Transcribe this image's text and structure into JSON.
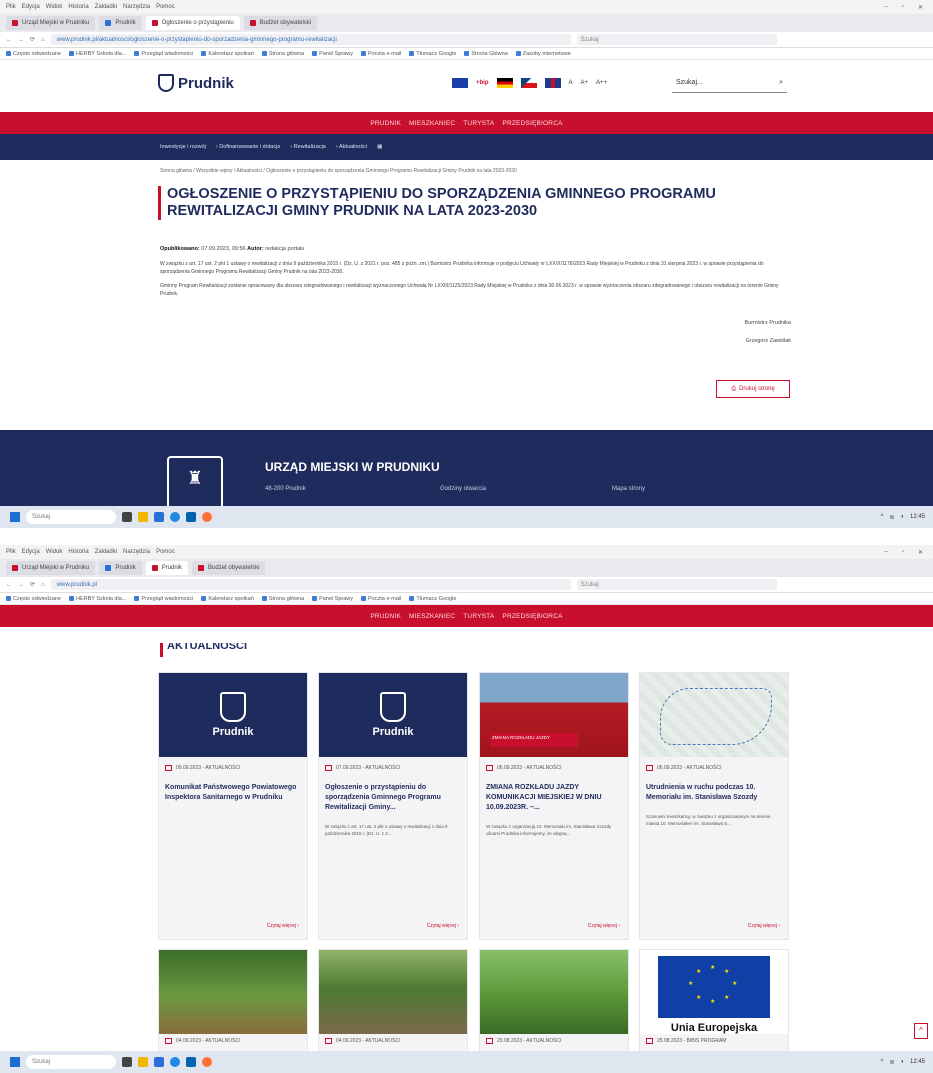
{
  "browser": {
    "menu": [
      "Plik",
      "Edycja",
      "Widok",
      "Historia",
      "Zakładki",
      "Narzędzia",
      "Pomoc"
    ],
    "tabs": [
      "Urząd Miejski w Prudniku",
      "Prudnik",
      "Ogłoszenie o przystąpieniu",
      "Budżet obywatelski"
    ],
    "url_top": "www.prudnik.pl/aktualnosci/ogloszenie-o-przystapieniu-do-sporzadzenia-gminnego-programu-rewitalizacji",
    "url_bottom": "www.prudnik.pl",
    "search_placeholder": "Szukaj",
    "bookmarks": [
      "Często odwiedzane",
      "HERBY Szkoła dla...",
      "Przegląd wiadomości",
      "Kalendarz spotkań",
      "Strona główna",
      "Panel Sprawy",
      "Poczta e-mail",
      "Tłumacz Google",
      "Strona Główna",
      "Zasoby internetowe"
    ]
  },
  "site": {
    "logo": "Prudnik",
    "lang_badge": "+bip",
    "font_tools": [
      "A",
      "A+",
      "A++"
    ],
    "search_placeholder": "Szukaj...",
    "search_icon": "magnifier-icon",
    "main_menu": [
      "PRUDNIK",
      "MIESZKANIEC",
      "TURYSTA",
      "PRZEDSIĘBIORCA"
    ],
    "sub_menu": [
      "Inwestycje i rozwój",
      "Dofinansowanie i dotacje",
      "Rewitalizacja",
      "Aktualności"
    ]
  },
  "article": {
    "breadcrumb": "Strona główna / Wszystkie wpisy / Aktualności / Ogłoszenie o przystąpieniu do sporządzenia Gminnego Programu Rewitalizacji Gminy Prudnik na lata 2023-2030",
    "title": "OGŁOSZENIE O PRZYSTĄPIENIU DO SPORZĄDZENIA GMINNEGO PROGRAMU REWITALIZACJI GMINY PRUDNIK NA LATA 2023-2030",
    "meta_label": "Opublikowano:",
    "meta_value": "07.09.2023, 09:56",
    "meta_author_label": "Autor:",
    "meta_author": "redakcja portalu",
    "paragraph1": "W związku z art. 17 ust. 2 pkt 1 ustawy o rewitalizacji z dnia 9 października 2015 r. (Dz. U. z 2021 r. poz. 485 z późn. zm.) Burmistrz Prudnika informuje o podjęciu Uchwały nr LXXVI/1178/2023 Rady Miejskiej w Prudniku z dnia 31 sierpnia 2023 r. w sprawie przystąpienia do sporządzenia Gminnego Programu Rewitalizacji Gminy Prudnik na lata 2023-2030.",
    "paragraph2": "Gminny Program Rewitalizacji zostanie opracowany dla obszaru zdegradowanego i rewitalizacji wyznaczonego Uchwałą Nr LXXIII/1125/2023 Rady Miejskiej w Prudniku z dnia 30.06.2023 r. w sprawie wyznaczenia obszaru zdegradowanego i obszaru rewitalizacji na terenie Gminy Prudnik.",
    "sign_title": "Burmistrz Prudnika",
    "sign_name": "Grzegorz Zawiślak",
    "print_label": "Drukuj stronę"
  },
  "footer": {
    "title": "URZĄD MIEJSKI W PRUDNIKU",
    "col1": "48-200 Prudnik",
    "col2": "Godziny otwarcia",
    "col3": "Mapa strony"
  },
  "taskbar": {
    "search_placeholder": "Szukaj",
    "time": "12:45"
  },
  "news": {
    "heading": "AKTUALNOŚCI",
    "read_more": "Czytaj więcej",
    "cards": [
      {
        "date": "09.09.2023 - AKTUALNOŚCI",
        "title": "Komunikat Państwowego Powiatowego Inspektora Sanitarnego w Prudniku",
        "lead": "",
        "img": "brand",
        "img_label": "Prudnik"
      },
      {
        "date": "07.09.2023 - AKTUALNOŚCI",
        "title": "Ogłoszenie o przystąpieniu do sporządzenia Gminnego Programu Rewitalizacji Gminy...",
        "lead": "W związku z art. 17 ust. 2 pkt 1 ustawy o rewitalizacji z dnia 9 października 2015 r. (Dz. U. z 2...",
        "img": "brand",
        "img_label": "Prudnik"
      },
      {
        "date": "06.09.2023 - AKTUALNOŚCI",
        "title": "ZMIANA ROZKŁADU JAZDY KOMUNIKACJI MIEJSKIEJ W DNIU 10.09.2023R. –...",
        "lead": "W związku z organizacją 10. Memoriału im. Stanisława Szozdy ulicami Prudnika informujemy, że ulegną...",
        "img": "bus",
        "img_label": "ZMIANA ROZKŁADU JAZDY"
      },
      {
        "date": "06.09.2023 - AKTUALNOŚCI",
        "title": "Utrudnienia w ruchu podczas 10. Memoriału im. Stanisława Szozdy",
        "lead": "Szanowni mieszkańcy, w związku z organizowanym na terenie miasta 10. Memoriałem im. Stanisława S...",
        "img": "map",
        "img_label": ""
      },
      {
        "date": "04.09.2023 - AKTUALNOŚCI",
        "img": "photo1"
      },
      {
        "date": "04.09.2023 - AKTUALNOŚCI",
        "img": "photo2"
      },
      {
        "date": "29.08.2023 - AKTUALNOŚCI",
        "img": "photo3"
      },
      {
        "date": "25.08.2023 - BIBIS PROGRAM",
        "img": "eu",
        "img_label": "Unia Europejska"
      }
    ]
  },
  "colors": {
    "accent_red": "#c8102e",
    "navy": "#1f2b5c"
  }
}
